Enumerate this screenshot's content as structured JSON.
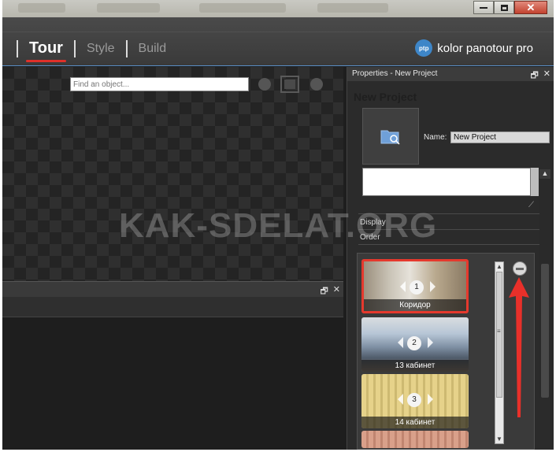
{
  "menu": {
    "tour": "Tour",
    "style": "Style",
    "build": "Build"
  },
  "brand": {
    "logo_text": "ptp",
    "name": "kolor panotour pro"
  },
  "viewer": {
    "find_placeholder": "Find an object..."
  },
  "properties": {
    "header": "Properties - New Project",
    "project_title": "New Project",
    "name_label": "Name:",
    "name_value": "New Project",
    "sections": {
      "display": "Display",
      "order": "Order"
    }
  },
  "panoramas": [
    {
      "number": "1",
      "label": "Коридор",
      "selected": true
    },
    {
      "number": "2",
      "label": "13 кабинет",
      "selected": false
    },
    {
      "number": "3",
      "label": "14 кабинет",
      "selected": false
    }
  ],
  "watermark": "KAK-SDELAT.ORG",
  "colors": {
    "accent": "#e0302a",
    "panel": "#2b2b2b",
    "viewer": "#242424"
  }
}
